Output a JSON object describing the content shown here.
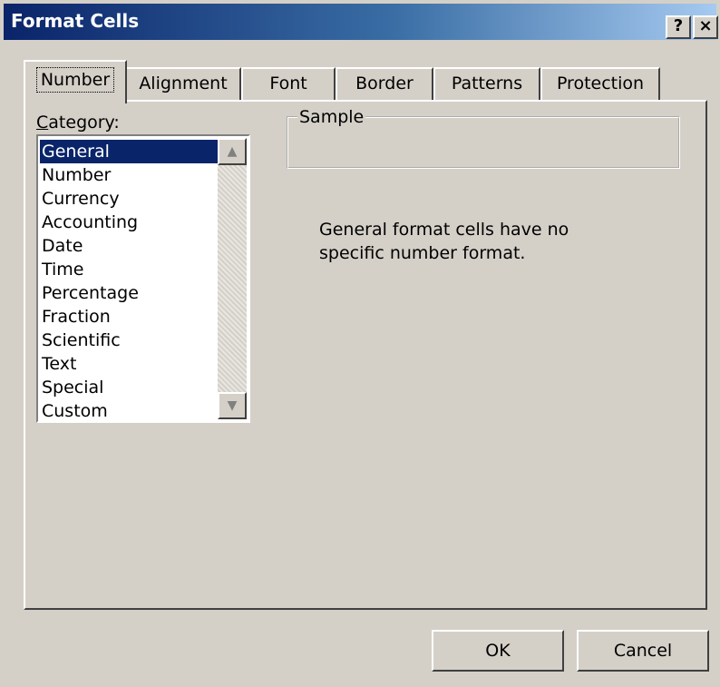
{
  "window": {
    "title": "Format Cells",
    "help_button": "?",
    "close_button": "×"
  },
  "tabs": [
    {
      "label": "Number",
      "active": true
    },
    {
      "label": "Alignment",
      "active": false
    },
    {
      "label": "Font",
      "active": false
    },
    {
      "label": "Border",
      "active": false
    },
    {
      "label": "Patterns",
      "active": false
    },
    {
      "label": "Protection",
      "active": false
    }
  ],
  "category": {
    "label_accel": "C",
    "label_rest": "ategory:",
    "items": [
      "General",
      "Number",
      "Currency",
      "Accounting",
      "Date",
      "Time",
      "Percentage",
      "Fraction",
      "Scientific",
      "Text",
      "Special",
      "Custom"
    ],
    "selected": "General"
  },
  "sample": {
    "legend": "Sample",
    "value": ""
  },
  "description": {
    "line1": "General format cells have no",
    "line2": "specific number format."
  },
  "buttons": {
    "ok": "OK",
    "cancel": "Cancel"
  },
  "colors": {
    "face": "#d4d0c8",
    "selection": "#0a246a",
    "title_start": "#0a246a",
    "title_end": "#a6caf0"
  }
}
